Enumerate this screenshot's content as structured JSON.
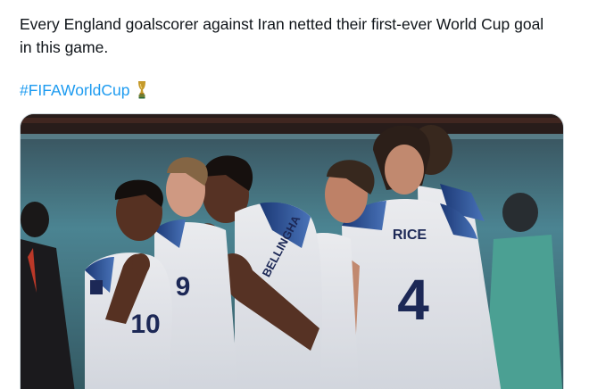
{
  "tweet": {
    "text_line1": "Every England goalscorer against Iran netted their first-ever World Cup goal",
    "text_line2": "in this game.",
    "hashtag": "#FIFAWorldCup",
    "emoji_icon": "trophy-icon"
  },
  "media": {
    "jersey_name_rice": "RICE",
    "jersey_number_rice": "4",
    "jersey_name_bellingham": "BELLINGHA",
    "jersey_number_left": "10",
    "jersey_number_mid": "9",
    "accent_color": "#1d9bf0"
  }
}
